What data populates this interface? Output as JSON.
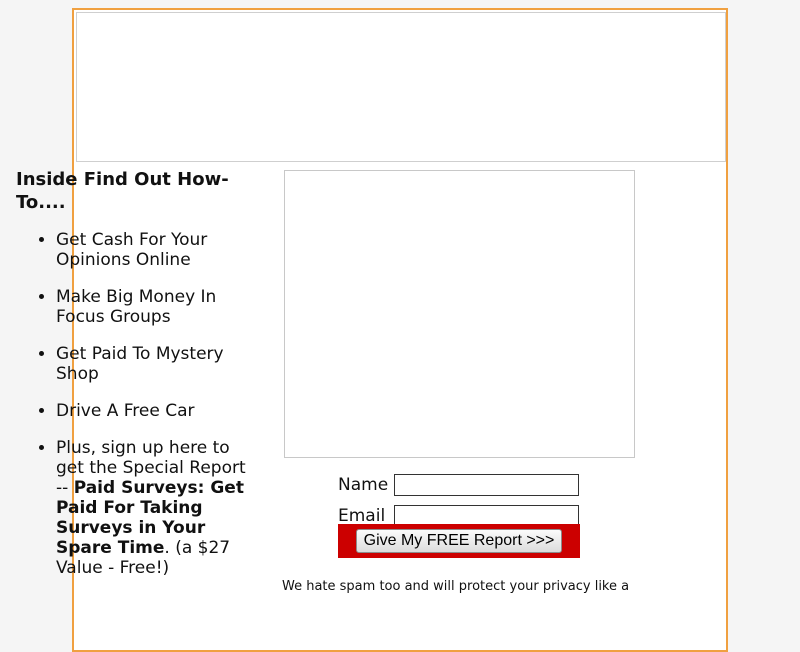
{
  "left": {
    "heading": "Inside Find Out How-To....",
    "bullets": [
      "Get Cash For Your Opinions Online",
      "Make Big Money In Focus Groups",
      "Get Paid To Mystery Shop",
      "Drive A Free Car"
    ],
    "last_bullet": {
      "intro": "Plus, sign up here to get the Special Report -- ",
      "report_title": "Paid Surveys: Get Paid For Taking Surveys in Your Spare Time",
      "outro": ". (a $27 Value - Free!)"
    }
  },
  "form": {
    "name_label": "Name",
    "name_value": "",
    "email_label": "Email",
    "email_value": "",
    "submit_label": "Give My FREE Report  >>>",
    "privacy_text": "We hate spam too and will protect your privacy like a"
  },
  "colors": {
    "page_border": "#f0a040",
    "submit_background": "#cc0000"
  }
}
